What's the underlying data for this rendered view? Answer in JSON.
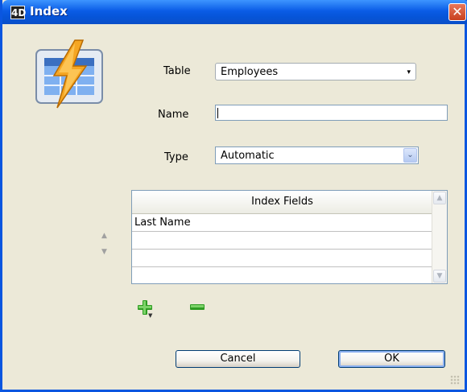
{
  "window": {
    "title": "Index",
    "app_icon_text": "4D",
    "close_glyph": "✕"
  },
  "form": {
    "table_label": "Table",
    "table_value": "Employees",
    "name_label": "Name",
    "name_value": "",
    "type_label": "Type",
    "type_value": "Automatic"
  },
  "index_fields": {
    "header": "Index Fields",
    "rows": [
      "Last Name",
      "",
      "",
      ""
    ]
  },
  "icons": {
    "table_icon": "table-lightning-icon",
    "up_arrow": "▲",
    "down_arrow": "▼",
    "scroll_up": "▲",
    "scroll_down": "▼",
    "dropdown": "▾",
    "combo_arrow": "⌄"
  },
  "buttons": {
    "cancel": "Cancel",
    "ok": "OK"
  },
  "colors": {
    "title_bar": "#0A5CE6",
    "dialog_bg": "#ECE9D8",
    "add_remove": "#2E9C22",
    "lightning": "#F0A020"
  }
}
